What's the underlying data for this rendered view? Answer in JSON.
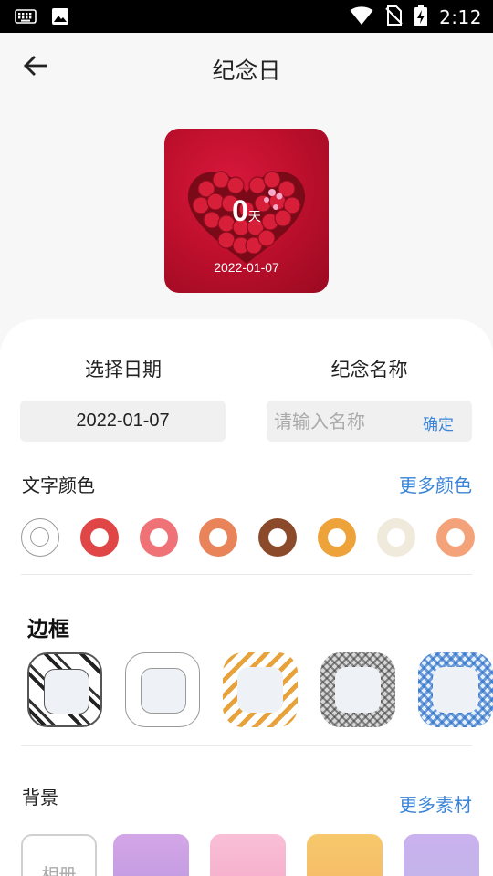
{
  "status_bar": {
    "time": "2:12",
    "icons": [
      "keyboard-icon",
      "image-icon",
      "wifi-icon",
      "no-sim-icon",
      "battery-charging-icon"
    ]
  },
  "header": {
    "title": "纪念日",
    "back_icon": "arrow-left-icon"
  },
  "preview": {
    "days": "0",
    "unit": "天",
    "date": "2022-01-07"
  },
  "form": {
    "date_label": "选择日期",
    "name_label": "纪念名称",
    "date_value": "2022-01-07",
    "name_placeholder": "请输入名称",
    "name_value": "",
    "confirm_label": "确定"
  },
  "text_color": {
    "title": "文字颜色",
    "more_label": "更多颜色",
    "swatches": [
      {
        "color": "#ffffff",
        "selected": true
      },
      {
        "color": "#e04646"
      },
      {
        "color": "#ee7276"
      },
      {
        "color": "#e8835a"
      },
      {
        "color": "#8b4a2a"
      },
      {
        "color": "#eea23a"
      },
      {
        "color": "#efeadb"
      },
      {
        "color": "#f4a279"
      }
    ]
  },
  "frame": {
    "title": "边框",
    "styles": [
      "black-stripe-frame",
      "plain-gray-frame",
      "orange-stripe-frame",
      "gray-plaid-frame",
      "blue-gingham-frame"
    ]
  },
  "background": {
    "title": "背景",
    "more_label": "更多素材",
    "album_label": "相册",
    "swatches": [
      "#c9a3e6",
      "#f7b6d2",
      "#f7c168",
      "#c6b4ec"
    ]
  },
  "colors": {
    "accent": "#3b84d6",
    "preview_bg": "#c0102e"
  }
}
